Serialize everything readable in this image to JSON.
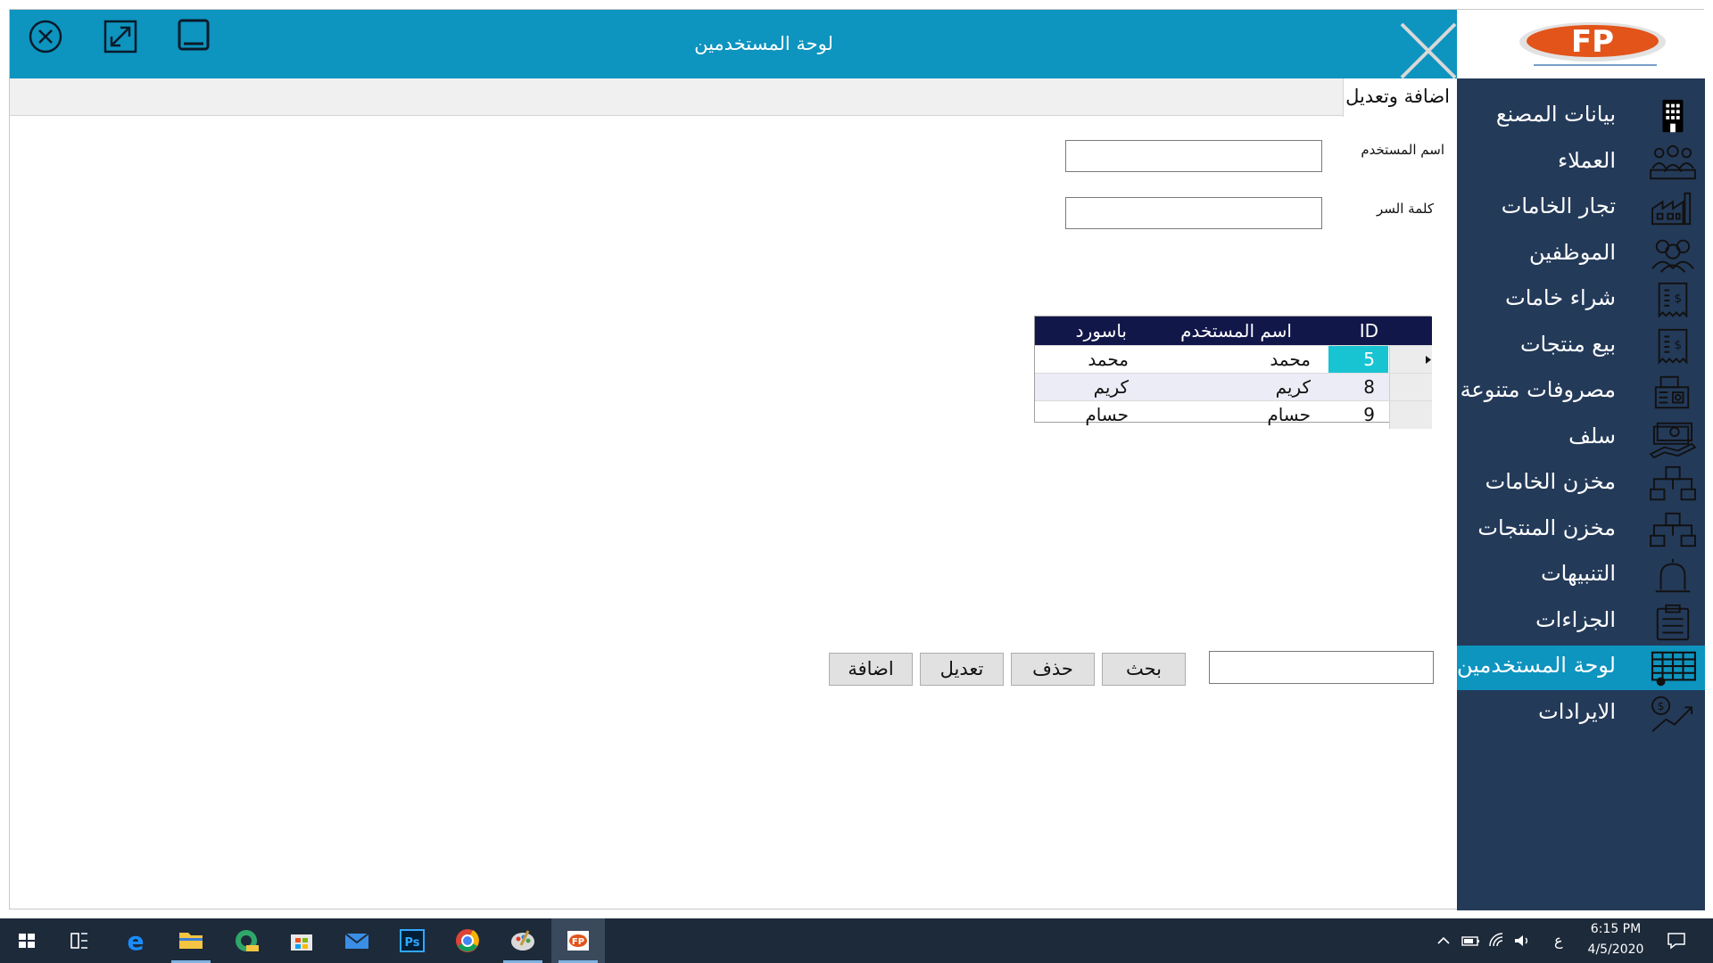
{
  "window": {
    "title": "لوحة المستخدمين"
  },
  "logo": {
    "text": "FP"
  },
  "sidebar": {
    "items": [
      {
        "label": "بيانات المصنع",
        "icon": "building-icon"
      },
      {
        "label": "العملاء",
        "icon": "customers-icon"
      },
      {
        "label": "تجار الخامات",
        "icon": "factory-icon"
      },
      {
        "label": "الموظفين",
        "icon": "employees-icon"
      },
      {
        "label": "شراء خامات",
        "icon": "receipt-icon"
      },
      {
        "label": "بيع منتجات",
        "icon": "receipt-icon"
      },
      {
        "label": "مصروفات متنوعة",
        "icon": "cash-register-icon"
      },
      {
        "label": "سلف",
        "icon": "loan-icon"
      },
      {
        "label": "مخزن الخامات",
        "icon": "warehouse-icon"
      },
      {
        "label": "مخزن المنتجات",
        "icon": "warehouse-icon"
      },
      {
        "label": "التنبيهات",
        "icon": "bell-icon"
      },
      {
        "label": "الجزاءات",
        "icon": "clipboard-icon"
      },
      {
        "label": "لوحة المستخدمين",
        "icon": "users-table-icon",
        "active": true
      },
      {
        "label": "الايرادات",
        "icon": "revenue-icon"
      }
    ]
  },
  "tab": {
    "label": "اضافة وتعديل"
  },
  "form": {
    "username_label": "اسم المستخدم",
    "username_value": "",
    "password_label": "كلمة السر",
    "password_value": ""
  },
  "grid": {
    "columns": {
      "id": "ID",
      "username": "اسم المستخدم",
      "password": "باسورد"
    },
    "rows": [
      {
        "id": "5",
        "username": "محمد",
        "password": "محمد"
      },
      {
        "id": "8",
        "username": "كريم",
        "password": "كريم"
      },
      {
        "id": "9",
        "username": "حسام",
        "password": "حسام"
      }
    ]
  },
  "buttons": {
    "add": "اضافة",
    "edit": "تعديل",
    "delete": "حذف",
    "search": "بحث"
  },
  "search": {
    "value": ""
  },
  "taskbar": {
    "time": "6:15 PM",
    "date": "4/5/2020",
    "lang": "ع"
  },
  "colors": {
    "accent": "#0d94bf",
    "sidebar": "#243a59",
    "grid_header": "#12174a",
    "selection": "#19c4d2"
  }
}
